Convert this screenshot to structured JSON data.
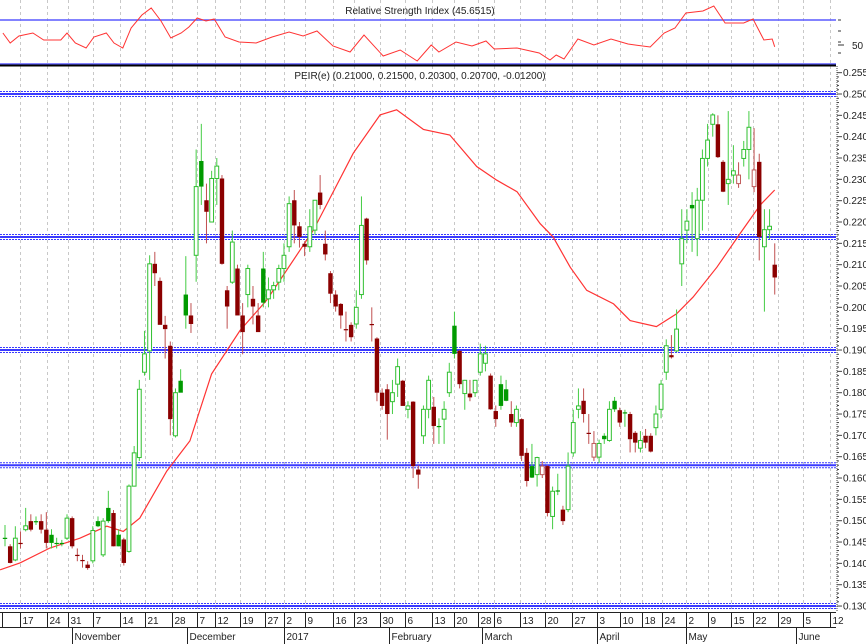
{
  "rsi_panel": {
    "title": "Relative Strength Index (45.6515)",
    "level_label": "50",
    "upper_level": 70,
    "lower_level": 30,
    "points": [
      [
        0.6,
        58.2
      ],
      [
        2,
        49.1
      ],
      [
        3.7,
        55.5
      ],
      [
        6.4,
        58.2
      ],
      [
        8.5,
        51.8
      ],
      [
        11.8,
        51.8
      ],
      [
        13,
        58.2
      ],
      [
        14.6,
        49.1
      ],
      [
        16.7,
        44.5
      ],
      [
        18.2,
        54.5
      ],
      [
        20.6,
        58.2
      ],
      [
        22.1,
        49.1
      ],
      [
        23.8,
        44.5
      ],
      [
        25.4,
        62.7
      ],
      [
        27.5,
        74.5
      ],
      [
        29.3,
        80.9
      ],
      [
        31.2,
        69.1
      ],
      [
        33.1,
        53.6
      ],
      [
        35.1,
        58.2
      ],
      [
        36.6,
        63.6
      ],
      [
        38.2,
        71.8
      ],
      [
        39.9,
        69.1
      ],
      [
        41.5,
        70.9
      ],
      [
        43.6,
        54.5
      ],
      [
        46.3,
        50
      ],
      [
        49.6,
        49.1
      ],
      [
        52.7,
        54.5
      ],
      [
        56,
        59.1
      ],
      [
        58.7,
        55.5
      ],
      [
        61.4,
        60
      ],
      [
        64.5,
        46.4
      ],
      [
        67.8,
        40.9
      ],
      [
        70.5,
        56.4
      ],
      [
        74.2,
        37.3
      ],
      [
        77.5,
        42.7
      ],
      [
        80.8,
        32.7
      ],
      [
        83.5,
        47.3
      ],
      [
        85,
        40.9
      ],
      [
        88.3,
        50
      ],
      [
        91.4,
        46.4
      ],
      [
        94.1,
        50.9
      ],
      [
        95.7,
        43.6
      ],
      [
        100.1,
        44.5
      ],
      [
        104.4,
        40
      ],
      [
        106.5,
        33.6
      ],
      [
        107.7,
        38.2
      ],
      [
        109.2,
        34.5
      ],
      [
        111.9,
        52.7
      ],
      [
        115,
        47.3
      ],
      [
        118.3,
        52.7
      ],
      [
        121.6,
        48.2
      ],
      [
        125.9,
        45.5
      ],
      [
        128.6,
        58.2
      ],
      [
        130.7,
        62.7
      ],
      [
        132.8,
        76.4
      ],
      [
        136.1,
        78.2
      ],
      [
        138.2,
        82.7
      ],
      [
        140.4,
        67.3
      ],
      [
        144,
        67.3
      ],
      [
        145.8,
        70.9
      ],
      [
        147.9,
        51.8
      ],
      [
        149.5,
        52.7
      ],
      [
        150,
        45.65
      ]
    ]
  },
  "price_panel": {
    "title": "PEIR(e) (0.21000, 0.21500, 0.20300, 0.20700, -0.01200)"
  },
  "chart_data": {
    "type": "candlestick",
    "title": "PEIR(e)",
    "ylim": [
      0.13,
      0.255
    ],
    "grid": true,
    "yticks": [
      "0.255",
      "0.250",
      "0.245",
      "0.240",
      "0.235",
      "0.230",
      "0.225",
      "0.220",
      "0.215",
      "0.210",
      "0.205",
      "0.200",
      "0.195",
      "0.190",
      "0.185",
      "0.180",
      "0.175",
      "0.170",
      "0.165",
      "0.160",
      "0.155",
      "0.150",
      "0.145",
      "0.140",
      "0.135",
      "0.130"
    ],
    "horizontal_levels": [
      0.25,
      0.2165,
      0.19,
      0.163,
      0.13
    ],
    "xticks": [
      {
        "label": "17",
        "idx": 3.9
      },
      {
        "label": "24",
        "idx": 9.1
      },
      {
        "label": "31",
        "idx": 13.2
      },
      {
        "label": "7",
        "idx": 18
      },
      {
        "label": "14",
        "idx": 23.3
      },
      {
        "label": "21",
        "idx": 28.1
      },
      {
        "label": "28",
        "idx": 33.3
      },
      {
        "label": "7",
        "idx": 38.2
      },
      {
        "label": "12",
        "idx": 41.6
      },
      {
        "label": "19",
        "idx": 46.5
      },
      {
        "label": "27",
        "idx": 51.3
      },
      {
        "label": "2",
        "idx": 55
      },
      {
        "label": "9",
        "idx": 59.1
      },
      {
        "label": "16",
        "idx": 64.5
      },
      {
        "label": "23",
        "idx": 68.6
      },
      {
        "label": "30",
        "idx": 73.6
      },
      {
        "label": "6",
        "idx": 78.4
      },
      {
        "label": "13",
        "idx": 83.7
      },
      {
        "label": "20",
        "idx": 87.9
      },
      {
        "label": "28",
        "idx": 92.6
      },
      {
        "label": "6",
        "idx": 95.7
      },
      {
        "label": "13",
        "idx": 100.7
      },
      {
        "label": "20",
        "idx": 105.5
      },
      {
        "label": "27",
        "idx": 110.8
      },
      {
        "label": "3",
        "idx": 115.6
      },
      {
        "label": "10",
        "idx": 120
      },
      {
        "label": "18",
        "idx": 124.3
      },
      {
        "label": "24",
        "idx": 128.2
      },
      {
        "label": "2",
        "idx": 132.8
      },
      {
        "label": "9",
        "idx": 137.1
      },
      {
        "label": "15",
        "idx": 141.5
      },
      {
        "label": "22",
        "idx": 145.8
      },
      {
        "label": "29",
        "idx": 150.6
      },
      {
        "label": "5",
        "idx": 155.5
      },
      {
        "label": "12",
        "idx": 160.7
      }
    ],
    "months": [
      {
        "label": "November",
        "idx": 14
      },
      {
        "label": "December",
        "idx": 36.2
      },
      {
        "label": "2017",
        "idx": 55
      },
      {
        "label": "February",
        "idx": 75.3
      },
      {
        "label": "March",
        "idx": 93.3
      },
      {
        "label": "April",
        "idx": 115.6
      },
      {
        "label": "May",
        "idx": 132.8
      },
      {
        "label": "June",
        "idx": 154.1
      }
    ],
    "candles_ohlc": [
      [
        0.146,
        0.149,
        0.144,
        0.146
      ],
      [
        0.144,
        0.1445,
        0.14,
        0.1401
      ],
      [
        0.1408,
        0.1487,
        0.1405,
        0.1459
      ],
      [
        0.1448,
        0.1475,
        0.1435,
        0.1448
      ],
      [
        0.1479,
        0.153,
        0.1475,
        0.1488
      ],
      [
        0.1499,
        0.1515,
        0.1475,
        0.1479
      ],
      [
        0.1499,
        0.151,
        0.149,
        0.1499
      ],
      [
        0.1499,
        0.1515,
        0.147,
        0.1479
      ],
      [
        0.1479,
        0.152,
        0.1435,
        0.1448
      ],
      [
        0.1467,
        0.148,
        0.1435,
        0.1448
      ],
      [
        0.1448,
        0.146,
        0.1435,
        0.1448
      ],
      [
        0.1448,
        0.1455,
        0.144,
        0.1448
      ],
      [
        0.1459,
        0.1515,
        0.1455,
        0.1506
      ],
      [
        0.1506,
        0.151,
        0.1435,
        0.144
      ],
      [
        0.142,
        0.1435,
        0.1405,
        0.142
      ],
      [
        0.1408,
        0.142,
        0.139,
        0.1408
      ],
      [
        0.1397,
        0.1405,
        0.1385,
        0.1389
      ],
      [
        0.1406,
        0.1487,
        0.14,
        0.1477
      ],
      [
        0.1499,
        0.151,
        0.1485,
        0.1487
      ],
      [
        0.142,
        0.1506,
        0.1415,
        0.1499
      ],
      [
        0.153,
        0.157,
        0.1495,
        0.1499
      ],
      [
        0.1518,
        0.1525,
        0.144,
        0.144
      ],
      [
        0.1467,
        0.148,
        0.144,
        0.144
      ],
      [
        0.1456,
        0.146,
        0.1395,
        0.1401
      ],
      [
        0.1428,
        0.1585,
        0.1425,
        0.1581
      ],
      [
        0.1581,
        0.1675,
        0.158,
        0.1659
      ],
      [
        0.1648,
        0.183,
        0.164,
        0.1808
      ],
      [
        0.1848,
        0.1945,
        0.184,
        0.1891
      ],
      [
        0.1898,
        0.2122,
        0.183,
        0.2102
      ],
      [
        0.2102,
        0.213,
        0.205,
        0.208
      ],
      [
        0.2062,
        0.207,
        0.196,
        0.1959
      ],
      [
        0.1959,
        0.198,
        0.188,
        0.1949
      ],
      [
        0.191,
        0.192,
        0.17,
        0.1738
      ],
      [
        0.1699,
        0.181,
        0.1695,
        0.18
      ],
      [
        0.1828,
        0.1855,
        0.181,
        0.18
      ],
      [
        0.203,
        0.212,
        0.195,
        0.1981
      ],
      [
        0.1981,
        0.201,
        0.194,
        0.1961
      ],
      [
        0.2122,
        0.237,
        0.206,
        0.2283
      ],
      [
        0.2343,
        0.243,
        0.224,
        0.2283
      ],
      [
        0.2251,
        0.229,
        0.215,
        0.2224
      ],
      [
        0.22,
        0.232,
        0.22,
        0.2302
      ],
      [
        0.2302,
        0.235,
        0.224,
        0.2331
      ],
      [
        0.2302,
        0.231,
        0.21,
        0.2102
      ],
      [
        0.204,
        0.205,
        0.195,
        0.2002
      ],
      [
        0.2059,
        0.218,
        0.2055,
        0.2153
      ],
      [
        0.2091,
        0.21,
        0.199,
        0.1981
      ],
      [
        0.1981,
        0.201,
        0.189,
        0.1942
      ],
      [
        0.203,
        0.21,
        0.2,
        0.2091
      ],
      [
        0.202,
        0.205,
        0.196,
        0.2002
      ],
      [
        0.1981,
        0.201,
        0.195,
        0.1942
      ],
      [
        0.2091,
        0.213,
        0.2,
        0.2011
      ],
      [
        0.202,
        0.207,
        0.2,
        0.2041
      ],
      [
        0.2041,
        0.206,
        0.202,
        0.2051
      ],
      [
        0.2059,
        0.21,
        0.204,
        0.2091
      ],
      [
        0.2091,
        0.215,
        0.206,
        0.2122
      ],
      [
        0.2142,
        0.226,
        0.213,
        0.2243
      ],
      [
        0.2251,
        0.2275,
        0.215,
        0.2192
      ],
      [
        0.219,
        0.22,
        0.214,
        0.2165
      ],
      [
        0.2149,
        0.2155,
        0.212,
        0.2142
      ],
      [
        0.2142,
        0.223,
        0.213,
        0.2189
      ],
      [
        0.2181,
        0.225,
        0.217,
        0.2251
      ],
      [
        0.2269,
        0.231,
        0.223,
        0.224
      ],
      [
        0.2149,
        0.218,
        0.211,
        0.2124
      ],
      [
        0.208,
        0.2085,
        0.201,
        0.2032
      ],
      [
        0.203,
        0.204,
        0.199,
        0.2002
      ],
      [
        0.2008,
        0.201,
        0.195,
        0.1981
      ],
      [
        0.1949,
        0.199,
        0.192,
        0.1949
      ],
      [
        0.1959,
        0.1965,
        0.192,
        0.193
      ],
      [
        0.1961,
        0.204,
        0.195,
        0.2
      ],
      [
        0.203,
        0.226,
        0.202,
        0.2192
      ],
      [
        0.2208,
        0.221,
        0.21,
        0.211
      ],
      [
        0.1961,
        0.2,
        0.192,
        0.1961
      ],
      [
        0.1927,
        0.193,
        0.178,
        0.18
      ],
      [
        0.18,
        0.181,
        0.176,
        0.1769
      ],
      [
        0.1808,
        0.182,
        0.169,
        0.175
      ],
      [
        0.1779,
        0.183,
        0.175,
        0.18
      ],
      [
        0.182,
        0.188,
        0.179,
        0.1861
      ],
      [
        0.1828,
        0.183,
        0.177,
        0.1769
      ],
      [
        0.1761,
        0.178,
        0.174,
        0.1769
      ],
      [
        0.1779,
        0.178,
        0.16,
        0.1628
      ],
      [
        0.162,
        0.163,
        0.1575,
        0.1608
      ],
      [
        0.1699,
        0.177,
        0.168,
        0.1761
      ],
      [
        0.1761,
        0.184,
        0.174,
        0.1829
      ],
      [
        0.1767,
        0.179,
        0.168,
        0.1722
      ],
      [
        0.1722,
        0.174,
        0.168,
        0.1722
      ],
      [
        0.1738,
        0.178,
        0.168,
        0.1761
      ],
      [
        0.18,
        0.187,
        0.179,
        0.1848
      ],
      [
        0.1957,
        0.199,
        0.188,
        0.1891
      ],
      [
        0.1898,
        0.19,
        0.181,
        0.182
      ],
      [
        0.1798,
        0.183,
        0.176,
        0.1829
      ],
      [
        0.1798,
        0.183,
        0.178,
        0.1789
      ],
      [
        0.18,
        0.183,
        0.179,
        0.1829
      ],
      [
        0.1848,
        0.1915,
        0.184,
        0.1891
      ],
      [
        0.1869,
        0.191,
        0.185,
        0.1891
      ],
      [
        0.184,
        0.1845,
        0.176,
        0.1761
      ],
      [
        0.1757,
        0.177,
        0.172,
        0.1738
      ],
      [
        0.182,
        0.184,
        0.176,
        0.1769
      ],
      [
        0.1808,
        0.183,
        0.178,
        0.1781
      ],
      [
        0.175,
        0.178,
        0.172,
        0.173
      ],
      [
        0.173,
        0.177,
        0.172,
        0.1761
      ],
      [
        0.1738,
        0.174,
        0.164,
        0.1652
      ],
      [
        0.1659,
        0.167,
        0.158,
        0.1593
      ],
      [
        0.1628,
        0.168,
        0.16,
        0.1601
      ],
      [
        0.1608,
        0.165,
        0.158,
        0.1648
      ],
      [
        0.1608,
        0.164,
        0.16,
        0.1628
      ],
      [
        0.1628,
        0.163,
        0.151,
        0.1518
      ],
      [
        0.151,
        0.158,
        0.148,
        0.1569
      ],
      [
        0.1571,
        0.161,
        0.156,
        0.1571
      ],
      [
        0.1526,
        0.1535,
        0.149,
        0.1499
      ],
      [
        0.1526,
        0.166,
        0.152,
        0.1628
      ],
      [
        0.1659,
        0.176,
        0.165,
        0.173
      ],
      [
        0.1761,
        0.181,
        0.174,
        0.1769
      ],
      [
        0.1781,
        0.181,
        0.173,
        0.175
      ],
      [
        0.1706,
        0.175,
        0.168,
        0.1706
      ],
      [
        0.1649,
        0.171,
        0.164,
        0.1681
      ],
      [
        0.1649,
        0.169,
        0.1635,
        0.1681
      ],
      [
        0.1699,
        0.1705,
        0.168,
        0.1691
      ],
      [
        0.1688,
        0.178,
        0.1685,
        0.1761
      ],
      [
        0.1781,
        0.179,
        0.1755,
        0.1761
      ],
      [
        0.1759,
        0.1765,
        0.172,
        0.173
      ],
      [
        0.1754,
        0.176,
        0.172,
        0.1754
      ],
      [
        0.175,
        0.1755,
        0.166,
        0.1691
      ],
      [
        0.1706,
        0.171,
        0.166,
        0.1683
      ],
      [
        0.167,
        0.171,
        0.166,
        0.1688
      ],
      [
        0.1699,
        0.1715,
        0.167,
        0.1683
      ],
      [
        0.1699,
        0.1705,
        0.166,
        0.1662
      ],
      [
        0.1718,
        0.177,
        0.17,
        0.175
      ],
      [
        0.1761,
        0.183,
        0.174,
        0.182
      ],
      [
        0.1848,
        0.1925,
        0.183,
        0.191
      ],
      [
        0.1888,
        0.1935,
        0.188,
        0.1883
      ],
      [
        0.1898,
        0.1995,
        0.1895,
        0.1949
      ],
      [
        0.2102,
        0.223,
        0.205,
        0.2161
      ],
      [
        0.2181,
        0.223,
        0.215,
        0.2202
      ],
      [
        0.224,
        0.227,
        0.213,
        0.2232
      ],
      [
        0.2161,
        0.228,
        0.212,
        0.2251
      ],
      [
        0.2251,
        0.237,
        0.218,
        0.2349
      ],
      [
        0.2349,
        0.243,
        0.233,
        0.2392
      ],
      [
        0.2429,
        0.2455,
        0.24,
        0.2451
      ],
      [
        0.2429,
        0.245,
        0.235,
        0.2352
      ],
      [
        0.2341,
        0.2345,
        0.227,
        0.2271
      ],
      [
        0.229,
        0.246,
        0.224,
        0.23
      ],
      [
        0.231,
        0.238,
        0.229,
        0.232
      ],
      [
        0.229,
        0.234,
        0.228,
        0.231
      ],
      [
        0.2349,
        0.239,
        0.233,
        0.237
      ],
      [
        0.237,
        0.246,
        0.23,
        0.2422
      ],
      [
        0.2283,
        0.242,
        0.227,
        0.2322
      ],
      [
        0.2341,
        0.236,
        0.211,
        0.2165
      ],
      [
        0.2142,
        0.223,
        0.199,
        0.2182
      ],
      [
        0.2182,
        0.223,
        0.216,
        0.219
      ],
      [
        0.21,
        0.215,
        0.203,
        0.207
      ]
    ],
    "moving_average": [
      [
        0,
        0.1385
      ],
      [
        3.9,
        0.1401
      ],
      [
        9.7,
        0.1436
      ],
      [
        15.5,
        0.1459
      ],
      [
        20.7,
        0.1487
      ],
      [
        23.9,
        0.1475
      ],
      [
        27.1,
        0.1506
      ],
      [
        32.3,
        0.1616
      ],
      [
        36.8,
        0.1687
      ],
      [
        41,
        0.1844
      ],
      [
        46.5,
        0.1946
      ],
      [
        51.6,
        0.2016
      ],
      [
        54.2,
        0.2063
      ],
      [
        60.7,
        0.2181
      ],
      [
        68.4,
        0.2361
      ],
      [
        73.6,
        0.2451
      ],
      [
        76.8,
        0.2463
      ],
      [
        82,
        0.2417
      ],
      [
        87.1,
        0.2404
      ],
      [
        92.3,
        0.233
      ],
      [
        96.2,
        0.2298
      ],
      [
        100.1,
        0.2271
      ],
      [
        104.6,
        0.2196
      ],
      [
        107.1,
        0.2165
      ],
      [
        110.4,
        0.2094
      ],
      [
        113.6,
        0.204
      ],
      [
        118.8,
        0.2008
      ],
      [
        122,
        0.1969
      ],
      [
        127.1,
        0.1955
      ],
      [
        131,
        0.1985
      ],
      [
        134.2,
        0.2024
      ],
      [
        138.8,
        0.2094
      ],
      [
        143.3,
        0.2173
      ],
      [
        147.2,
        0.224
      ],
      [
        150,
        0.2275
      ]
    ],
    "colors": {
      "up": "#2fbf2f",
      "up_filled": "#009a00",
      "down": "#8b0000",
      "down_hollow": "#c05a5a",
      "ma": "#ff3333",
      "rsi": "#ff3333",
      "level": "#3a3aff",
      "grid": "#c8c8c8"
    }
  }
}
